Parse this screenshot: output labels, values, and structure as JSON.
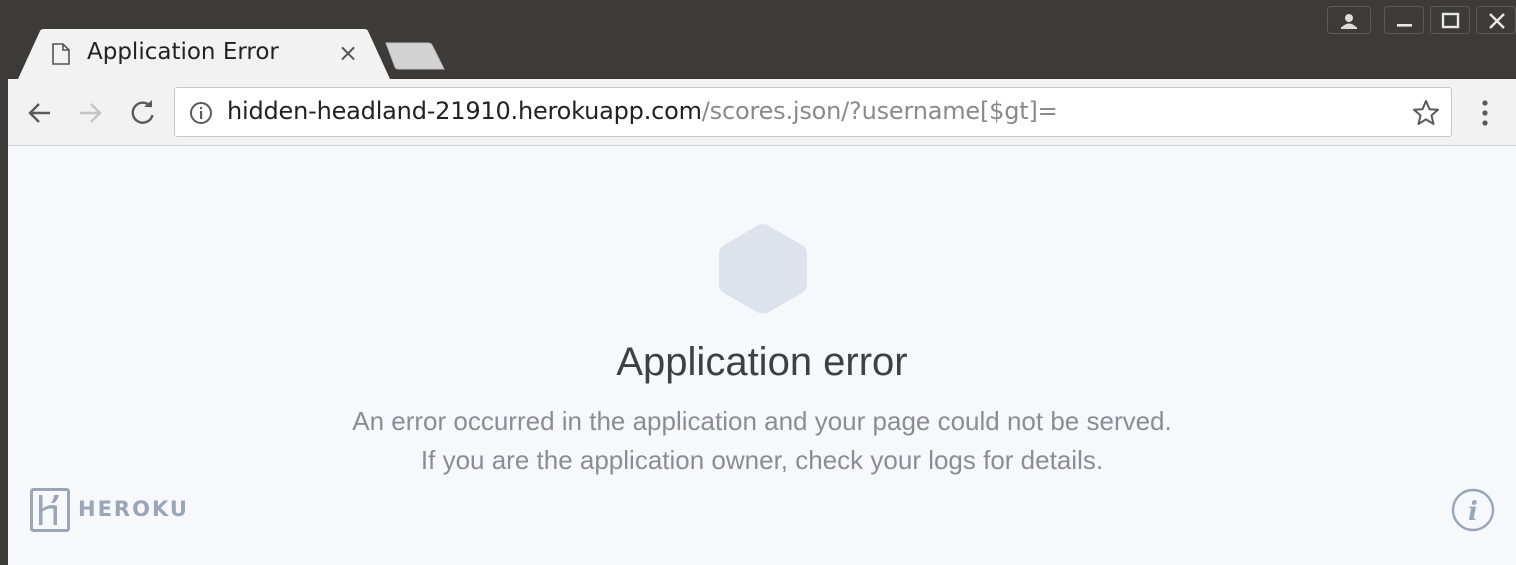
{
  "tab": {
    "title": "Application Error",
    "close_glyph": "×",
    "favicon": "document-icon"
  },
  "omnibox": {
    "host": "hidden-headland-21910.herokuapp.com",
    "path": "/scores.json/?username[$gt]="
  },
  "page": {
    "title": "Application error",
    "message": "An error occurred in the application and your page could not be served. If you are the application owner, check your logs for details.",
    "brand": "HEROKU",
    "hexagon_color": "#dde2ec",
    "brand_color": "#9aa6b8"
  },
  "icons": {
    "back": "arrow-left-icon",
    "forward": "arrow-right-icon",
    "reload": "reload-icon",
    "info": "info-icon",
    "star": "star-icon",
    "menu": "kebab-menu-icon"
  }
}
